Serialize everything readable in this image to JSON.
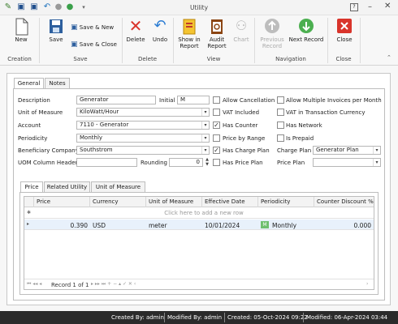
{
  "window": {
    "title": "Utility"
  },
  "ribbon": {
    "new": "New",
    "save": "Save",
    "save_new": "Save & New",
    "save_close": "Save & Close",
    "delete": "Delete",
    "undo": "Undo",
    "show_in_report": [
      "Show in",
      "Report"
    ],
    "audit_report": [
      "Audit",
      "Report"
    ],
    "chart": "Chart",
    "previous_record": [
      "Previous",
      "Record"
    ],
    "next_record": "Next Record",
    "close": "Close",
    "groups": {
      "creation": "Creation",
      "save": "Save",
      "delete": "Delete",
      "view": "View",
      "navigation": "Navigation",
      "close": "Close"
    }
  },
  "tabs": {
    "general": "General",
    "notes": "Notes"
  },
  "form": {
    "description_label": "Description",
    "description": "Generator",
    "initial_label": "Initial",
    "initial": "M",
    "unit_label": "Unit of Measure",
    "unit": "KiloWatt/Hour",
    "account_label": "Account",
    "account": "7110  -  Generator",
    "periodicity_label": "Periodicity",
    "periodicity": "Monthly",
    "beneficiary_label": "Beneficiary Company",
    "beneficiary": "Southstrom",
    "uom_col_label": "UOM Column Header",
    "uom_col": "",
    "rounding_label": "Rounding",
    "rounding": "0",
    "allow_cancellation": "Allow Cancellation",
    "vat_included": "VAT Included",
    "has_counter": "Has Counter",
    "price_by_range": "Price by Range",
    "has_charge_plan": "Has Charge Plan",
    "has_price_plan": "Has Price Plan",
    "allow_multi_invoices": "Allow Multiple Invoices per Month",
    "vat_tx_currency": "VAT in Transaction Currency",
    "has_network": "Has Network",
    "is_prepaid": "Is Prepaid",
    "charge_plan_label": "Charge Plan",
    "charge_plan": "Generator Plan",
    "price_plan_label": "Price Plan",
    "price_plan": "",
    "checks": {
      "allow_cancellation": false,
      "vat_included": false,
      "has_counter": true,
      "price_by_range": false,
      "has_charge_plan": true,
      "has_price_plan": false,
      "allow_multi_invoices": false,
      "vat_tx_currency": false,
      "has_network": false,
      "is_prepaid": false
    }
  },
  "subtabs": {
    "price": "Price",
    "related": "Related Utility",
    "unit": "Unit of Measure"
  },
  "grid": {
    "columns": [
      "Price",
      "Currency",
      "Unit of Measure",
      "Effective Date",
      "Periodicity",
      "Counter Discount %"
    ],
    "add_row_text": "Click here to add a new row",
    "rows": [
      {
        "price": "0.390",
        "currency": "USD",
        "unit": "meter",
        "date": "10/01/2024",
        "periodicity": "Monthly",
        "discount": "0.000"
      }
    ],
    "nav": "Record 1 of 1"
  },
  "status": {
    "created_by": "Created By: admin",
    "modified_by": "Modified By: admin",
    "created": "Created: 05-Oct-2024 09:22",
    "modified": "Modified: 06-Apr-2024 03:44"
  },
  "colors": {
    "accent": "#2b7cd3",
    "delete_red": "#d9342b",
    "next_green": "#4caf50",
    "statusbar": "#2b2b2b"
  }
}
